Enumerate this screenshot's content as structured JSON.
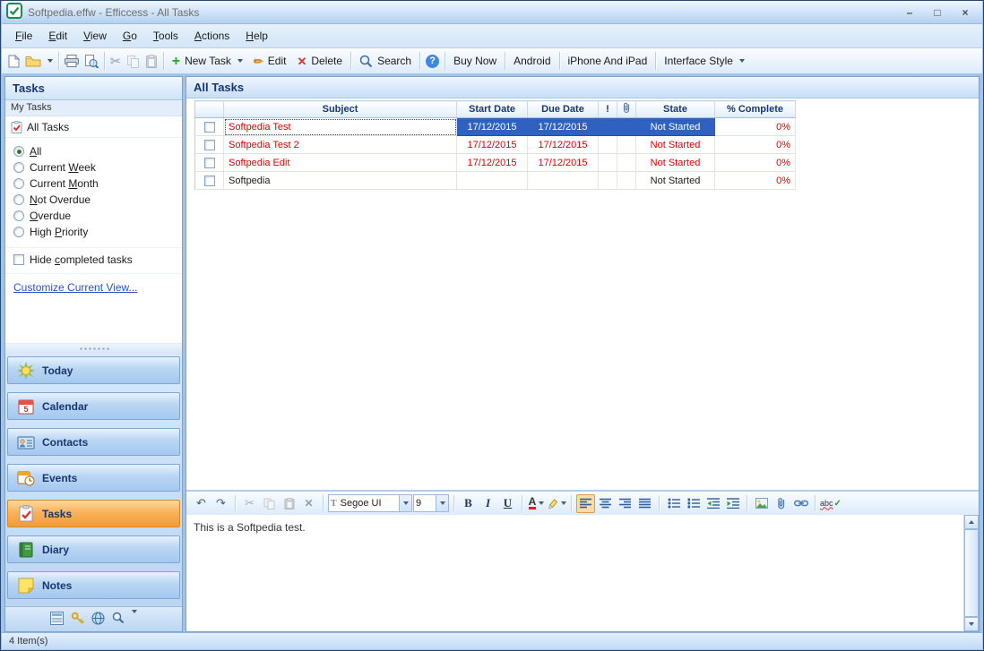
{
  "window": {
    "title": "Softpedia.effw - Efficcess - All Tasks"
  },
  "icons": {
    "minimize": "–",
    "maximize": "□",
    "close": "×",
    "cut": "✂",
    "undo": "↶",
    "redo": "↷",
    "delete_x": "✕",
    "plus": "+",
    "pencil": "✏",
    "help": "?",
    "truetype": "T",
    "check": "✓",
    "spellcheck_text": "abc"
  },
  "menubar": {
    "items": [
      "&File",
      "&Edit",
      "&View",
      "&Go",
      "&Tools",
      "&Actions",
      "&Help"
    ]
  },
  "toolbar": {
    "new_task": "New Task",
    "edit": "Edit",
    "delete": "Delete",
    "search": "Search",
    "buy_now": "Buy Now",
    "android": "Android",
    "iphone_and_ipad": "iPhone And iPad",
    "interface_style": "Interface Style"
  },
  "sidebar": {
    "title": "Tasks",
    "group": "My Tasks",
    "current_view": "All Tasks",
    "filters": [
      {
        "label": "&All",
        "selected": true
      },
      {
        "label": "Current &Week",
        "selected": false
      },
      {
        "label": "Current &Month",
        "selected": false
      },
      {
        "label": "&Not Overdue",
        "selected": false
      },
      {
        "label": "&Overdue",
        "selected": false
      },
      {
        "label": "High &Priority",
        "selected": false
      }
    ],
    "hide_completed_label": "Hide &completed tasks",
    "hide_completed_checked": false,
    "customize_link": "C&ustomize Current View...",
    "nav": [
      {
        "label": "Today",
        "active": false
      },
      {
        "label": "Calendar",
        "active": false
      },
      {
        "label": "Contacts",
        "active": false
      },
      {
        "label": "Events",
        "active": false
      },
      {
        "label": "Tasks",
        "active": true
      },
      {
        "label": "Diary",
        "active": false
      },
      {
        "label": "Notes",
        "active": false
      }
    ]
  },
  "main": {
    "header": "All Tasks",
    "table": {
      "headers": {
        "subject": "Subject",
        "start_date": "Start Date",
        "due_date": "Due Date",
        "priority": "!",
        "attachment_icon": "paperclip-icon",
        "state": "State",
        "complete": "% Complete"
      },
      "rows": [
        {
          "subject": "Softpedia Test",
          "start_date": "17/12/2015",
          "due_date": "17/12/2015",
          "state": "Not Started",
          "complete": "0%",
          "selected": true
        },
        {
          "subject": "Softpedia Test 2",
          "start_date": "17/12/2015",
          "due_date": "17/12/2015",
          "state": "Not Started",
          "complete": "0%",
          "selected": false
        },
        {
          "subject": "Softpedia Edit",
          "start_date": "17/12/2015",
          "due_date": "17/12/2015",
          "state": "Not Started",
          "complete": "0%",
          "selected": false
        },
        {
          "subject": "Softpedia",
          "start_date": "",
          "due_date": "",
          "state": "Not Started",
          "complete": "0%",
          "selected": false
        }
      ]
    }
  },
  "editor": {
    "font_name": "Segoe UI",
    "font_size": "9",
    "bold": "B",
    "italic": "I",
    "underline": "U",
    "font_color": "A",
    "content": "This is a Softpedia test."
  },
  "statusbar": {
    "text": "4 Item(s)"
  },
  "colors": {
    "selection_blue": "#2e61c0",
    "overdue_red": "#e10000",
    "active_nav_orange": "#f7a23b",
    "header_text_blue": "#17376e"
  }
}
